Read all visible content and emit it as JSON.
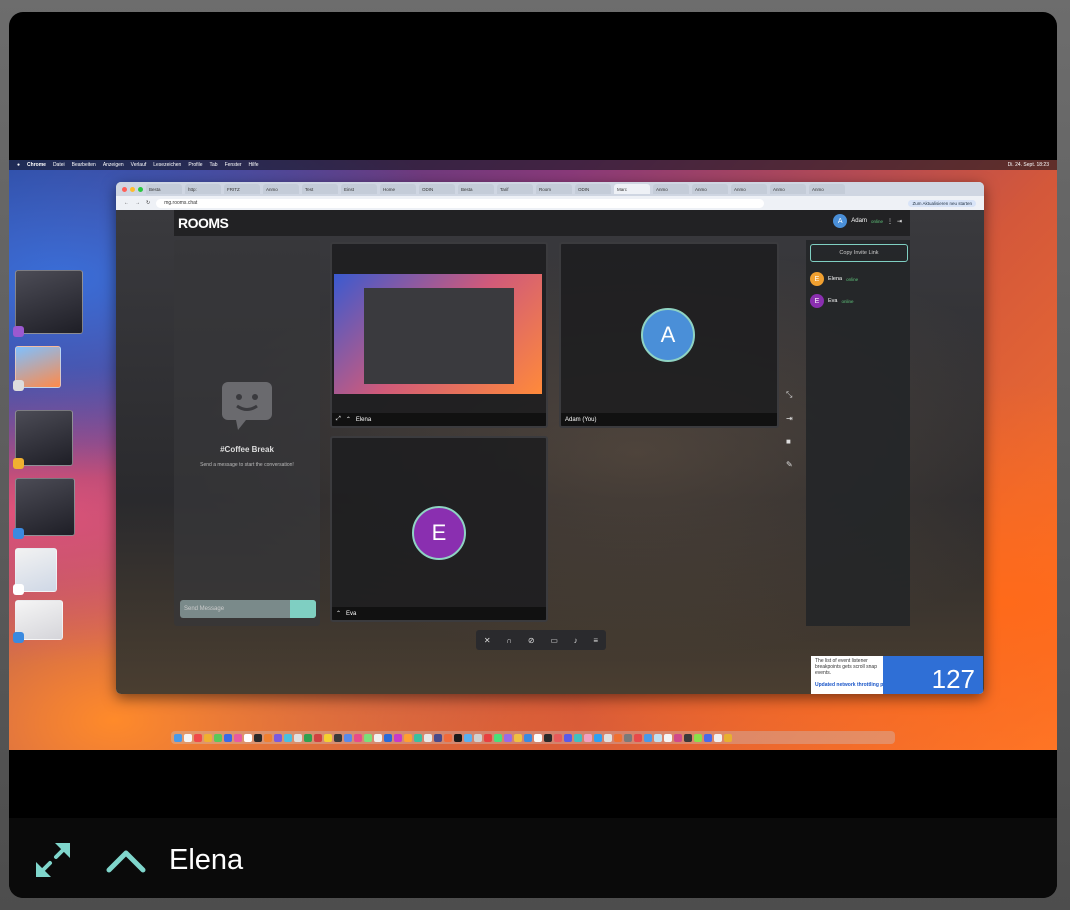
{
  "tile": {
    "participant_name": "Elena"
  },
  "shared_screen": {
    "menubar": {
      "app": "Chrome",
      "items": [
        "Datei",
        "Bearbeiten",
        "Anzeigen",
        "Verlauf",
        "Lesezeichen",
        "Profile",
        "Tab",
        "Fenster",
        "Hilfe"
      ],
      "clock": "Di. 24. Sept. 18:23"
    },
    "browser": {
      "url": "mg.rooms.chat",
      "update_button": "Zum Aktualisieren neu starten",
      "tabs": [
        "Besta",
        "http:",
        "FRITZ",
        "Anmo",
        "Test",
        "Einst",
        "Home",
        "ODIN",
        "Besta",
        "Tarif",
        "Room",
        "ODIN",
        "Marc",
        "Anmo",
        "Anmo",
        "Anmo",
        "Anmo",
        "Anmo"
      ]
    },
    "rooms": {
      "logo": "ROOMS",
      "current_user": {
        "name": "Adam",
        "status": "online",
        "initial": "A"
      },
      "chat": {
        "title": "#Coffee Break",
        "subtitle": "Send a message to start the conversation!",
        "input_placeholder": "Send Message"
      },
      "tiles": [
        {
          "name": "Elena",
          "initial": ""
        },
        {
          "name": "Adam (You)",
          "initial": "A",
          "color": "#4a8fd8"
        },
        {
          "name": "Eva",
          "initial": "E",
          "color": "#8a2fb0"
        }
      ],
      "invite_button": "Copy Invite Link",
      "members": [
        {
          "name": "Elena",
          "status": "online",
          "initial": "E",
          "color": "#f0a030"
        },
        {
          "name": "Eva",
          "status": "online",
          "initial": "E",
          "color": "#8a2fb0"
        }
      ]
    },
    "devtools": {
      "text": "The list of event listener breakpoints gets scroll snap events.",
      "link": "Updated network throttling presets",
      "number": "127"
    }
  },
  "colors": {
    "accent": "#7fd6cc",
    "tile_bg": "#000000",
    "bar_bg": "#0a0a0a"
  }
}
